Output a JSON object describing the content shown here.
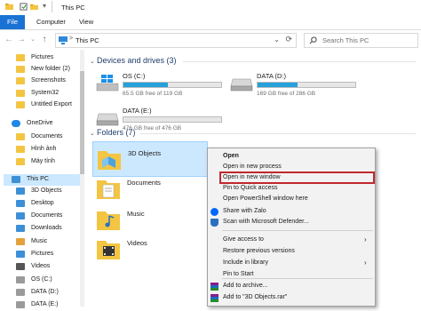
{
  "window": {
    "title": "This PC"
  },
  "ribbon": {
    "tabs": [
      "File",
      "Computer",
      "View"
    ]
  },
  "address": {
    "path": "This PC",
    "separator": ">"
  },
  "search": {
    "placeholder": "Search This PC"
  },
  "nav": {
    "items": [
      {
        "label": "Pictures",
        "icon": "pictures-folder-icon"
      },
      {
        "label": "New folder (2)",
        "icon": "folder-icon"
      },
      {
        "label": "Screenshots",
        "icon": "folder-icon"
      },
      {
        "label": "System32",
        "icon": "folder-icon"
      },
      {
        "label": "Untitled Export",
        "icon": "folder-icon"
      },
      {
        "label": "OneDrive",
        "icon": "onedrive-icon"
      },
      {
        "label": "Documents",
        "icon": "folder-icon"
      },
      {
        "label": "Hình ảnh",
        "icon": "folder-icon"
      },
      {
        "label": "Máy tính",
        "icon": "folder-icon"
      },
      {
        "label": "This PC",
        "icon": "this-pc-icon",
        "selected": true
      },
      {
        "label": "3D Objects",
        "icon": "3d-objects-icon"
      },
      {
        "label": "Desktop",
        "icon": "desktop-icon"
      },
      {
        "label": "Documents",
        "icon": "documents-icon"
      },
      {
        "label": "Downloads",
        "icon": "downloads-icon"
      },
      {
        "label": "Music",
        "icon": "music-icon"
      },
      {
        "label": "Pictures",
        "icon": "pictures-icon"
      },
      {
        "label": "Videos",
        "icon": "videos-icon"
      },
      {
        "label": "OS (C:)",
        "icon": "drive-icon"
      },
      {
        "label": "DATA (D:)",
        "icon": "drive-icon"
      },
      {
        "label": "DATA (E:)",
        "icon": "drive-icon"
      }
    ]
  },
  "devices": {
    "header": "Devices and drives (3)",
    "drives": [
      {
        "name": "OS (C:)",
        "free": "65.5 GB free of 119 GB",
        "used_fraction": 0.45
      },
      {
        "name": "DATA (D:)",
        "free": "169 GB free of 286 GB",
        "used_fraction": 0.41
      },
      {
        "name": "DATA (E:)",
        "free": "476 GB free of 476 GB",
        "used_fraction": 0.0
      }
    ]
  },
  "folders": {
    "header": "Folders (7)",
    "items": [
      {
        "label": "3D Objects",
        "selected": true
      },
      {
        "label": "Documents"
      },
      {
        "label": "Music"
      },
      {
        "label": "Videos"
      }
    ]
  },
  "context_menu": {
    "items": [
      {
        "label": "Open",
        "bold": true
      },
      {
        "label": "Open in new process"
      },
      {
        "label": "Open in new window",
        "highlighted": true
      },
      {
        "label": "Pin to Quick access"
      },
      {
        "label": "Open PowerShell window here"
      },
      {
        "label": "Share with Zalo",
        "icon": "zalo-icon"
      },
      {
        "label": "Scan with Microsoft Defender...",
        "icon": "defender-icon"
      },
      {
        "label": "Give access to",
        "submenu": true
      },
      {
        "label": "Restore previous versions"
      },
      {
        "label": "Include in library",
        "submenu": true
      },
      {
        "label": "Pin to Start"
      },
      {
        "label": "Add to archive...",
        "icon": "winrar-icon"
      },
      {
        "label": "Add to \"3D Objects.rar\"",
        "icon": "winrar-icon"
      }
    ]
  },
  "colors": {
    "accent": "#1a73d4",
    "selection": "#cce8ff",
    "drive_bar": "#26a0da",
    "highlight_box": "#c1272d",
    "folder_yellow": "#f4c542"
  }
}
